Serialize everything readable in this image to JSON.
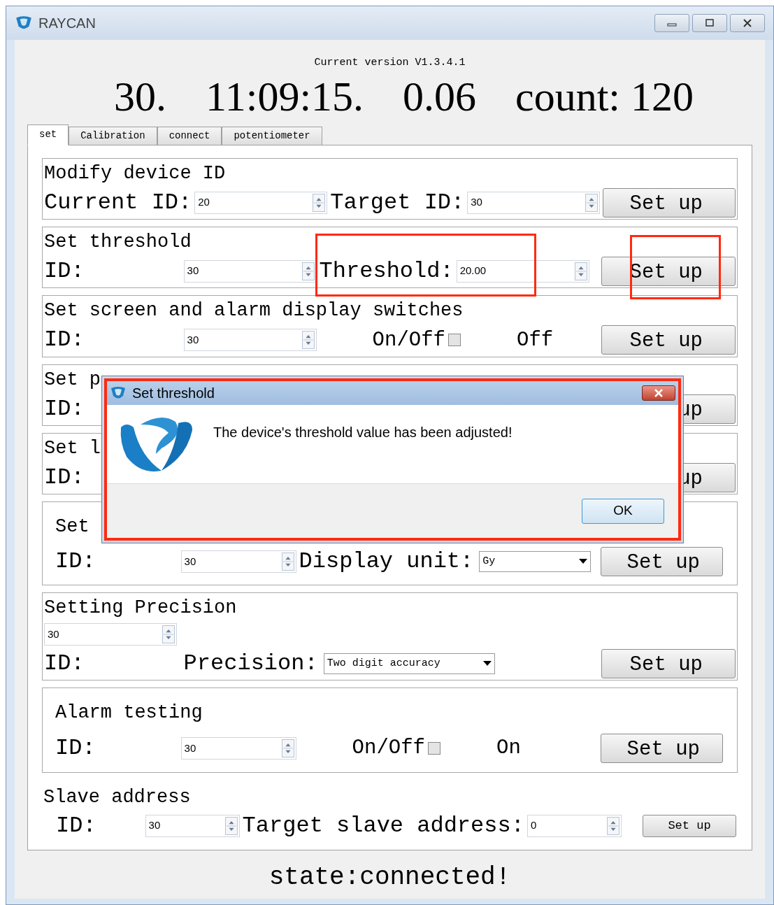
{
  "window": {
    "title": "RAYCAN"
  },
  "header": {
    "version": "Current version V1.3.4.1",
    "readings": [
      "30.",
      "11:09:15.",
      "0.06",
      "count: 120"
    ]
  },
  "tabs": [
    {
      "label": "set",
      "selected": true
    },
    {
      "label": "Calibration",
      "selected": false
    },
    {
      "label": "connect",
      "selected": false
    },
    {
      "label": "potentiometer",
      "selected": false
    }
  ],
  "sections": [
    {
      "kind": "box",
      "rows": [
        [
          {
            "kind": "title",
            "text": "Modify device ID"
          }
        ],
        [
          {
            "kind": "label",
            "text": "Current ID:"
          },
          {
            "kind": "spin",
            "value": "20"
          },
          {
            "kind": "label",
            "text": "Target ID:"
          },
          {
            "kind": "spin",
            "value": "30"
          },
          {
            "kind": "button",
            "text": "Set up"
          }
        ]
      ]
    },
    {
      "kind": "box",
      "rows": [
        [
          {
            "kind": "title",
            "text": "Set threshold"
          }
        ],
        [
          {
            "kind": "key",
            "text": "ID:"
          },
          {
            "kind": "spin",
            "value": "30"
          },
          {
            "kind": "label",
            "text": "Threshold:"
          },
          {
            "kind": "spin",
            "value": "20.00"
          },
          {
            "kind": "button",
            "text": "Set up"
          }
        ]
      ]
    },
    {
      "kind": "box",
      "rows": [
        [
          {
            "kind": "title",
            "text": "Set screen and alarm display switches"
          }
        ],
        [
          {
            "kind": "key",
            "text": "ID:"
          },
          {
            "kind": "spin",
            "value": "30"
          },
          {
            "kind": "check",
            "text": "On/Off",
            "checked": false
          },
          {
            "kind": "text",
            "text": "Off"
          },
          {
            "kind": "button",
            "text": "Set up"
          }
        ]
      ]
    },
    {
      "kind": "box",
      "rows": [
        [
          {
            "kind": "title",
            "text": "Set p"
          }
        ],
        [
          {
            "kind": "key",
            "text": "ID:"
          },
          {
            "kind": "button",
            "text": "up"
          }
        ]
      ]
    },
    {
      "kind": "box",
      "rows": [
        [
          {
            "kind": "title",
            "text": "Set l"
          }
        ],
        [
          {
            "kind": "key",
            "text": "ID:"
          },
          {
            "kind": "button",
            "text": "up"
          }
        ]
      ]
    },
    {
      "kind": "inset",
      "rows": [
        [
          {
            "kind": "title",
            "text": "Set"
          }
        ],
        [
          {
            "kind": "key",
            "text": "ID:"
          },
          {
            "kind": "spin",
            "value": "30"
          },
          {
            "kind": "label",
            "text": "Display unit:"
          },
          {
            "kind": "short_select",
            "value": "Gy"
          },
          {
            "kind": "button",
            "text": "Set up"
          }
        ]
      ]
    },
    {
      "kind": "box",
      "rows": [
        [
          {
            "kind": "title",
            "text": "Setting Precision"
          }
        ],
        [
          {
            "kind": "spin",
            "value": "30"
          }
        ],
        [
          {
            "kind": "key",
            "text": "ID:"
          },
          {
            "kind": "label",
            "text": "Precision:"
          },
          {
            "kind": "select",
            "value": "Two digit accuracy"
          },
          {
            "kind": "button",
            "text": "Set up"
          }
        ]
      ]
    },
    {
      "kind": "inset",
      "rows": [
        [
          {
            "kind": "title",
            "text": "Alarm testing"
          }
        ],
        [
          {
            "kind": "key",
            "text": "ID:"
          },
          {
            "kind": "spin",
            "value": "30"
          },
          {
            "kind": "check",
            "text": "On/Off",
            "checked": false
          },
          {
            "kind": "text",
            "text": "On"
          },
          {
            "kind": "button",
            "text": "Set up"
          }
        ]
      ]
    },
    {
      "kind": "plain",
      "rows": [
        [
          {
            "kind": "title",
            "text": "Slave address"
          }
        ],
        [
          {
            "kind": "key",
            "text": "ID:"
          },
          {
            "kind": "short_spin",
            "value": "30"
          },
          {
            "kind": "label",
            "text": "Target slave address:"
          },
          {
            "kind": "short_spin",
            "value": "0"
          },
          {
            "kind": "small_button",
            "text": "Set up"
          }
        ]
      ]
    }
  ],
  "status": "state:connected!",
  "dialog": {
    "title": "Set threshold",
    "message": "The device's threshold value has been adjusted!",
    "ok": "OK"
  }
}
